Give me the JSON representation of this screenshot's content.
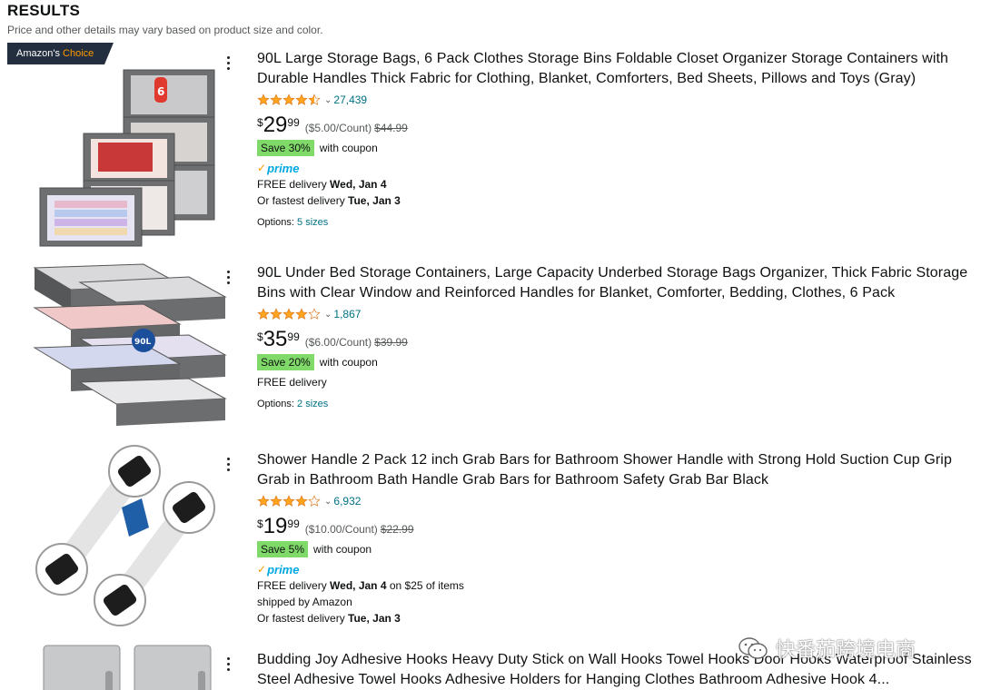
{
  "header": {
    "title": "RESULTS",
    "subtitle": "Price and other details may vary based on product size and color."
  },
  "colors": {
    "star": "#ffa41c",
    "save_bg": "#7fda69",
    "link": "#007185",
    "prime": "#00a8e1",
    "badge_bg": "#232f3e"
  },
  "products": [
    {
      "badge": {
        "prefix": "Amazon's",
        "suffix": "Choice"
      },
      "title": "90L Large Storage Bags, 6 Pack Clothes Storage Bins Foldable Closet Organizer Storage Containers with Durable Handles Thick Fabric for Clothing, Blanket, Comforters, Bed Sheets, Pillows and Toys (Gray)",
      "rating": 4.5,
      "rating_count": "27,439",
      "price_currency": "$",
      "price_whole": "29",
      "price_fraction": "99",
      "unit_price": "($5.00/Count)",
      "list_price": "$44.99",
      "save_label": "Save 30%",
      "coupon_text": "with coupon",
      "prime": true,
      "prime_label": "prime",
      "delivery1_prefix": "FREE delivery ",
      "delivery1_bold": "Wed, Jan 4",
      "delivery1_suffix": "",
      "delivery2_prefix": "Or fastest delivery ",
      "delivery2_bold": "Tue, Jan 3",
      "options_prefix": "Options: ",
      "options_link": "5 sizes",
      "image_icon": "storage-bags-image"
    },
    {
      "title": "90L Under Bed Storage Containers, Large Capacity Underbed Storage Bags Organizer, Thick Fabric Storage Bins with Clear Window and Reinforced Handles for Blanket, Comforter, Bedding, Clothes, 6 Pack",
      "rating": 4.0,
      "rating_count": "1,867",
      "price_currency": "$",
      "price_whole": "35",
      "price_fraction": "99",
      "unit_price": "($6.00/Count)",
      "list_price": "$39.99",
      "save_label": "Save 20%",
      "coupon_text": "with coupon",
      "prime": false,
      "delivery1_prefix": "FREE delivery",
      "options_prefix": "Options: ",
      "options_link": "2 sizes",
      "image_label": "90L",
      "image_icon": "underbed-bags-image"
    },
    {
      "title": "Shower Handle 2 Pack 12 inch Grab Bars for Bathroom Shower Handle with Strong Hold Suction Cup Grip Grab in Bathroom Bath Handle Grab Bars for Bathroom Safety Grab Bar Black",
      "rating": 4.0,
      "rating_count": "6,932",
      "price_currency": "$",
      "price_whole": "19",
      "price_fraction": "99",
      "unit_price": "($10.00/Count)",
      "list_price": "$22.99",
      "save_label": "Save 5%",
      "coupon_text": "with coupon",
      "prime": true,
      "prime_label": "prime",
      "delivery1_prefix": "FREE delivery ",
      "delivery1_bold": "Wed, Jan 4",
      "delivery1_suffix": " on $25 of items",
      "shipped_by": "shipped by Amazon",
      "delivery2_prefix": "Or fastest delivery ",
      "delivery2_bold": "Tue, Jan 3",
      "image_icon": "grab-bars-image"
    },
    {
      "title": "Budding Joy Adhesive Hooks Heavy Duty Stick on Wall Hooks Towel Hooks Door Hooks Waterproof Stainless Steel Adhesive Towel Hooks Adhesive Holders for Hanging Clothes Bathroom Adhesive Hook 4...",
      "image_icon": "adhesive-hooks-image"
    }
  ],
  "watermark": {
    "text": "快番茄跨境电商",
    "icon": "wechat-icon"
  }
}
